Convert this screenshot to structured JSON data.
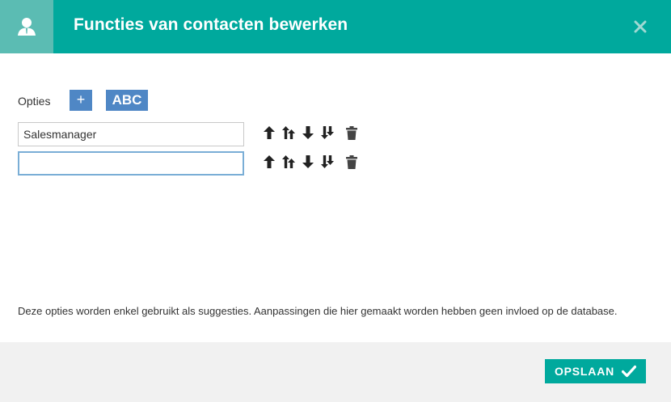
{
  "dialog": {
    "title": "Functies van contacten bewerken",
    "header_icon": "user-icon",
    "close_icon": "close-icon"
  },
  "options": {
    "label": "Opties",
    "add_label": "+",
    "sort_label": "ABC",
    "rows": [
      {
        "value": "Salesmanager",
        "placeholder": ""
      },
      {
        "value": "",
        "placeholder": ""
      }
    ],
    "row_action_icons": [
      "arrow-up-icon",
      "arrow-top-icon",
      "arrow-down-icon",
      "arrow-bottom-icon",
      "trash-icon"
    ]
  },
  "info": {
    "text": "Deze opties worden enkel gebruikt als suggesties. Aanpassingen die hier gemaakt worden hebben geen invloed op de database."
  },
  "footer": {
    "save_label": "OPSLAAN",
    "save_icon": "check-icon"
  },
  "colors": {
    "header": "#00a99d",
    "header_icon_box": "#5bbcb3",
    "button_blue": "#4f87c5",
    "footer_bg": "#f1f1f1"
  }
}
